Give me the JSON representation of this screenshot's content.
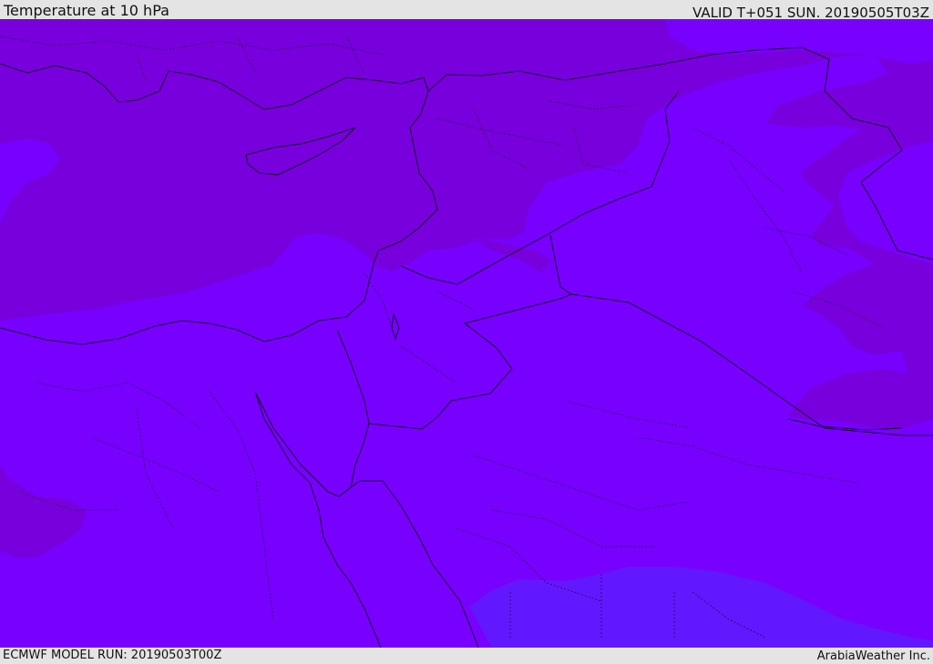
{
  "header": {
    "title": "Temperature at 10 hPa",
    "valid": "VALID T+051 SUN. 20190505T03Z"
  },
  "footer": {
    "model_run": "ECMWF MODEL RUN: 20190503T00Z",
    "credit": "ArabiaWeather Inc."
  },
  "map": {
    "field": "temperature",
    "level": "10 hPa",
    "region": "Eastern Mediterranean / Middle East",
    "colors": {
      "base": "#7800ff",
      "darker_band": "#7800dc",
      "cool_band": "#6218ff",
      "boundaries": "#1a0030"
    }
  }
}
